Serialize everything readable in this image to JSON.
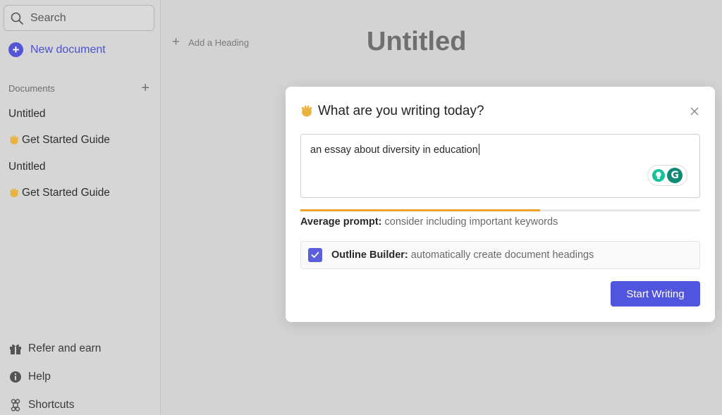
{
  "sidebar": {
    "search_placeholder": "Search",
    "new_document_label": "New document",
    "documents_header": "Documents",
    "documents": [
      {
        "label": "Untitled",
        "emoji": ""
      },
      {
        "label": "Get Started Guide",
        "emoji": "👋"
      },
      {
        "label": "Untitled",
        "emoji": ""
      },
      {
        "label": "Get Started Guide",
        "emoji": "👋"
      }
    ],
    "bottom": {
      "refer": "Refer and earn",
      "help": "Help",
      "shortcuts": "Shortcuts"
    }
  },
  "main": {
    "add_heading": "Add a Heading",
    "title": "Untitled"
  },
  "modal": {
    "title": "What are you writing today?",
    "title_emoji": "👋",
    "prompt_value": "an essay about diversity in education",
    "progress_fraction": 0.6,
    "prompt_quality_label": "Average prompt:",
    "prompt_quality_hint": "consider including important keywords",
    "outline_label": "Outline Builder:",
    "outline_hint": "automatically create document headings",
    "outline_checked": true,
    "start_button": "Start Writing"
  },
  "colors": {
    "accent": "#5155de",
    "progress": "#f0a12b",
    "grammarly": "#15c39a"
  }
}
